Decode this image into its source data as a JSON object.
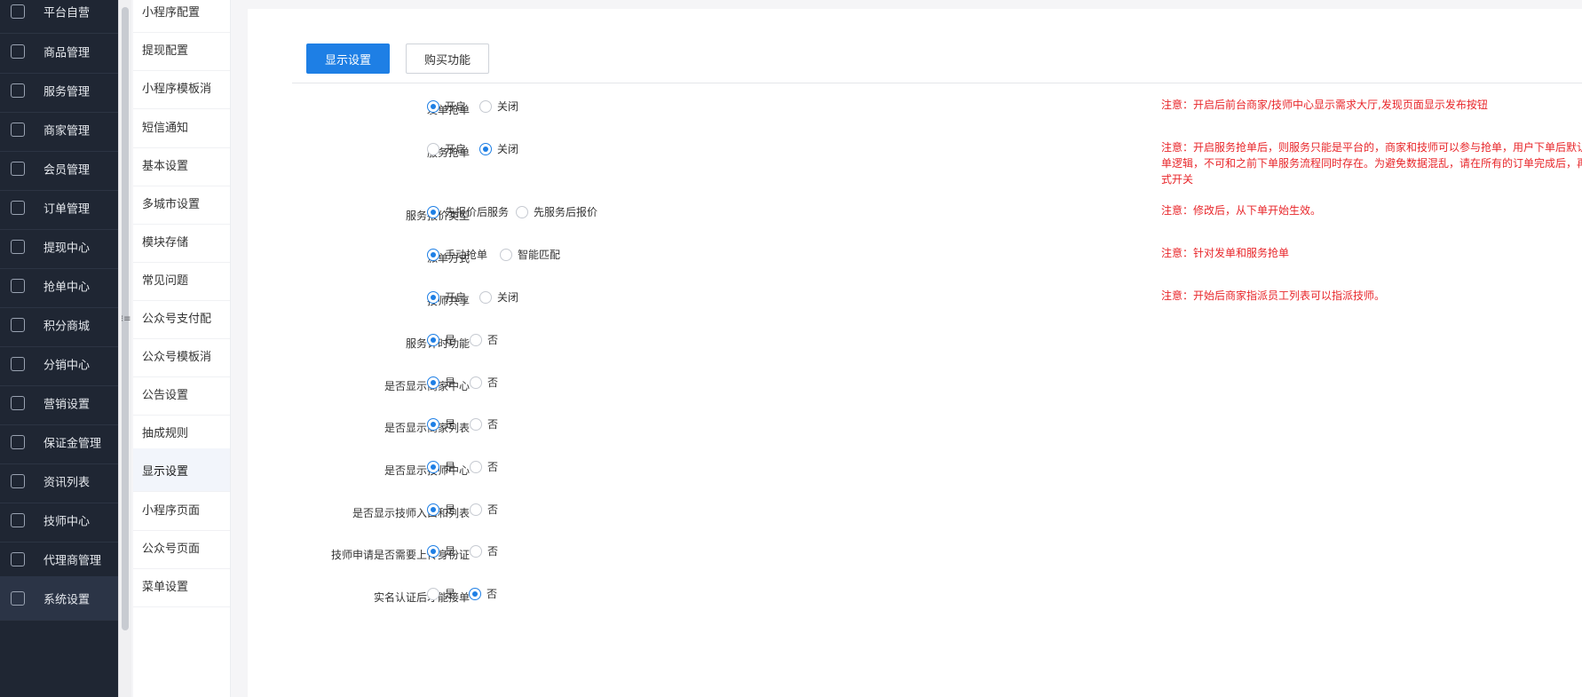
{
  "nav": {
    "items": [
      {
        "label": "平台自营",
        "icon": "laptop-icon",
        "active": false
      },
      {
        "label": "商品管理",
        "icon": "box-icon",
        "active": false
      },
      {
        "label": "服务管理",
        "icon": "heart-icon",
        "active": false
      },
      {
        "label": "商家管理",
        "icon": "store-icon",
        "active": false
      },
      {
        "label": "会员管理",
        "icon": "diamond-icon",
        "active": false
      },
      {
        "label": "订单管理",
        "icon": "clipboard-icon",
        "active": false
      },
      {
        "label": "提现中心",
        "icon": "money-bag-icon",
        "active": false
      },
      {
        "label": "抢单中心",
        "icon": "money-bag-icon",
        "active": false
      },
      {
        "label": "积分商城",
        "icon": "database-icon",
        "active": false
      },
      {
        "label": "分销中心",
        "icon": "database-icon",
        "active": false
      },
      {
        "label": "营销设置",
        "icon": "toolbox-icon",
        "active": false
      },
      {
        "label": "保证金管理",
        "icon": "shield-icon",
        "active": false
      },
      {
        "label": "资讯列表",
        "icon": "shield-icon",
        "active": false
      },
      {
        "label": "技师中心",
        "icon": "shield-icon",
        "active": false
      },
      {
        "label": "代理商管理",
        "icon": "shield-icon",
        "active": false
      },
      {
        "label": "系统设置",
        "icon": "gear-icon",
        "active": true
      }
    ],
    "collapse_glyph": "⁝≡"
  },
  "submenu": {
    "items": [
      "小程序配置",
      "提现配置",
      "小程序模板消",
      "短信通知",
      "基本设置",
      "多城市设置",
      "模块存储",
      "常见问题",
      "公众号支付配",
      "公众号模板消",
      "公告设置",
      "抽成规则",
      "显示设置",
      "小程序页面",
      "公众号页面",
      "菜单设置"
    ],
    "active_index": 12
  },
  "tabs": [
    {
      "label": "显示设置",
      "active": true
    },
    {
      "label": "购买功能",
      "active": false
    }
  ],
  "settings": [
    {
      "label": "发单抢单",
      "options": [
        "开启",
        "关闭"
      ],
      "selected": 0,
      "note": [
        "注意：开启后前台商家/技师中心显示需求大厅,发现页面显示发布按钮"
      ]
    },
    {
      "label": "服务抢单",
      "options": [
        "开启",
        "关闭"
      ],
      "selected": 1,
      "note": [
        "注意：开启服务抢单后，则服务只能是平台的，商家和技师可以参与抢单，用户下单后默认",
        "单逻辑，不可和之前下单服务流程同时存在。为避免数据混乱，请在所有的订单完成后，再",
        "式开关"
      ]
    },
    {
      "label": "服务报价类型",
      "options": [
        "先报价后服务",
        "先服务后报价"
      ],
      "selected": 0,
      "note": [
        "注意：修改后，从下单开始生效。"
      ]
    },
    {
      "label": "派单方式",
      "options": [
        "手动抢单",
        "智能匹配"
      ],
      "selected": 0,
      "note": [
        "注意：针对发单和服务抢单"
      ]
    },
    {
      "label": "技师共享",
      "options": [
        "开启",
        "关闭"
      ],
      "selected": 0,
      "note": [
        "注意：开始后商家指派员工列表可以指派技师。"
      ]
    },
    {
      "label": "服务计时功能",
      "options": [
        "是",
        "否"
      ],
      "selected": 0,
      "note": []
    },
    {
      "label": "是否显示商家中心",
      "options": [
        "是",
        "否"
      ],
      "selected": 0,
      "note": []
    },
    {
      "label": "是否显示商家列表",
      "options": [
        "是",
        "否"
      ],
      "selected": 0,
      "note": []
    },
    {
      "label": "是否显示技师中心",
      "options": [
        "是",
        "否"
      ],
      "selected": 0,
      "note": []
    },
    {
      "label": "是否显示技师入口和列表",
      "options": [
        "是",
        "否"
      ],
      "selected": 0,
      "note": []
    },
    {
      "label": "技师申请是否需要上传身份证",
      "options": [
        "是",
        "否"
      ],
      "selected": 0,
      "note": []
    },
    {
      "label": "实名认证后才能接单",
      "options": [
        "是",
        "否"
      ],
      "selected": 1,
      "note": []
    }
  ],
  "colors": {
    "primary": "#1e7fe5",
    "warning": "#e8262a",
    "nav_bg": "#1f2633"
  }
}
